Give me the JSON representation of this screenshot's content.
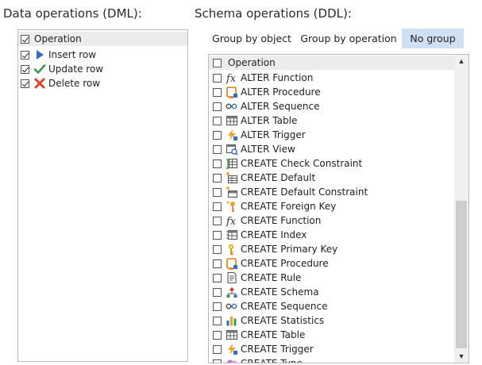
{
  "dml": {
    "title": "Data operations (DML):",
    "header": "Operation",
    "items": [
      {
        "label": "Insert row",
        "icon": "play-triangle-icon",
        "checked": true
      },
      {
        "label": "Update row",
        "icon": "checkmark-icon",
        "checked": true
      },
      {
        "label": "Delete row",
        "icon": "red-x-icon",
        "checked": true
      }
    ]
  },
  "ddl": {
    "title": "Schema operations (DDL):",
    "buttons": {
      "group_by_object": "Group by object",
      "group_by_operation": "Group by operation",
      "no_group": "No group"
    },
    "header": "Operation",
    "items": [
      {
        "label": "ALTER Function",
        "icon": "function-icon"
      },
      {
        "label": "ALTER Procedure",
        "icon": "procedure-icon"
      },
      {
        "label": "ALTER Sequence",
        "icon": "sequence-icon"
      },
      {
        "label": "ALTER Table",
        "icon": "table-icon"
      },
      {
        "label": "ALTER Trigger",
        "icon": "trigger-icon"
      },
      {
        "label": "ALTER View",
        "icon": "view-icon"
      },
      {
        "label": "CREATE Check Constraint",
        "icon": "check-constraint-icon"
      },
      {
        "label": "CREATE Default",
        "icon": "default-icon"
      },
      {
        "label": "CREATE Default Constraint",
        "icon": "default-constraint-icon"
      },
      {
        "label": "CREATE Foreign Key",
        "icon": "foreign-key-icon"
      },
      {
        "label": "CREATE Function",
        "icon": "function-icon"
      },
      {
        "label": "CREATE Index",
        "icon": "index-icon"
      },
      {
        "label": "CREATE Primary Key",
        "icon": "primary-key-icon"
      },
      {
        "label": "CREATE Procedure",
        "icon": "procedure-icon"
      },
      {
        "label": "CREATE Rule",
        "icon": "rule-icon"
      },
      {
        "label": "CREATE Schema",
        "icon": "schema-icon"
      },
      {
        "label": "CREATE Sequence",
        "icon": "sequence-icon"
      },
      {
        "label": "CREATE Statistics",
        "icon": "statistics-icon"
      },
      {
        "label": "CREATE Table",
        "icon": "table-icon"
      },
      {
        "label": "CREATE Trigger",
        "icon": "trigger-icon"
      },
      {
        "label": "CREATE Type",
        "icon": "type-icon"
      }
    ]
  },
  "colors": {
    "selected_button": "#cfe0f5",
    "header_row": "#ececec",
    "insert": "#2f6fc0",
    "update": "#3a9a4a",
    "delete": "#d9412b"
  }
}
